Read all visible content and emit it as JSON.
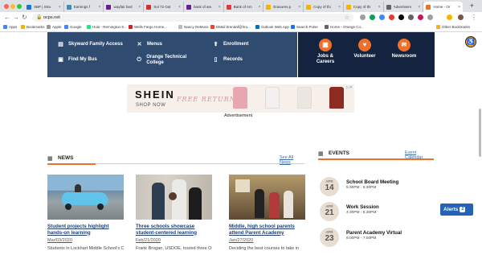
{
  "browser": {
    "tabs": [
      {
        "title": "SBP | Stra",
        "color": "#1a73e8"
      },
      {
        "title": "Earnings f",
        "color": "#3c8dbc"
      },
      {
        "title": "wayfair bed",
        "color": "#6a1b9a"
      },
      {
        "title": "Sol 72 Out",
        "color": "#d32f2f"
      },
      {
        "title": "bank of am",
        "color": "#6a1b9a"
      },
      {
        "title": "Bank of Am",
        "color": "#e53935"
      },
      {
        "title": "Erasures.p",
        "color": "#f4b400"
      },
      {
        "title": "Copy of thi",
        "color": "#f4b400"
      },
      {
        "title": "Copy of thi",
        "color": "#f4b400"
      },
      {
        "title": "Advertisem",
        "color": "#5f6368"
      },
      {
        "title": "Home - Or",
        "color": "#f0702b",
        "active": true
      }
    ],
    "url": "ocps.net",
    "bookmarks": [
      {
        "label": "Apps",
        "color": "#4285f4"
      },
      {
        "label": "Bookmarks",
        "color": "#f4b400"
      },
      {
        "label": "Apple",
        "color": "#999999"
      },
      {
        "label": "Google",
        "color": "#4285f4"
      },
      {
        "label": "Hulu - Remington S...",
        "color": "#1ce783"
      },
      {
        "label": "Wells Fargo Home...",
        "color": "#d71e28"
      },
      {
        "label": "Nancy DeMoss",
        "color": "#bbbbbb"
      },
      {
        "label": "DMail brendaf@hru...",
        "color": "#ea4335"
      },
      {
        "label": "Outlook Web App",
        "color": "#0072c6"
      },
      {
        "label": "Search Pulse",
        "color": "#1a73e8"
      },
      {
        "label": "Home - Orange Co...",
        "color": "#5f6368"
      },
      {
        "label": "Other Bookmarks",
        "color": "#f4b400"
      }
    ]
  },
  "quicklinks": [
    {
      "label": "Skyward Family Access",
      "icon": "card-icon"
    },
    {
      "label": "Menus",
      "icon": "utensils-icon"
    },
    {
      "label": "Enrollment",
      "icon": "arrow-up-icon"
    },
    {
      "label": "Find My Bus",
      "icon": "bus-icon"
    },
    {
      "label": "Orange Technical College",
      "icon": "power-icon"
    },
    {
      "label": "Records",
      "icon": "document-icon"
    }
  ],
  "featured": [
    {
      "label": "Jobs & Careers",
      "icon": "briefcase-icon"
    },
    {
      "label": "Volunteer",
      "icon": "heart-icon"
    },
    {
      "label": "Newsroom",
      "icon": "megaphone-icon"
    }
  ],
  "ad": {
    "brand": "SHEIN",
    "cta": "SHOP NOW",
    "script": "FREE RETURN",
    "label": "Advertisement"
  },
  "news": {
    "title": "NEWS",
    "see_all": "See All News",
    "stories": [
      {
        "title": "Student projects highlight hands-on learning",
        "date": "Mar/03/2020",
        "snippet": "Students in Lockhart Middle School's CASE"
      },
      {
        "title": "Three schools showcase student-centered learning",
        "date": "Feb/21/2020",
        "snippet": "Frank Brogan, USDOE, toured three OCPS"
      },
      {
        "title": "Middle, high school parents attend Parent Academy",
        "date": "Jan/27/2020",
        "snippet": "Deciding the best courses to take in"
      }
    ]
  },
  "events": {
    "title": "EVENTS",
    "calendar_link": "Event Calendar",
    "items": [
      {
        "month": "APR",
        "day": "14",
        "title": "School Board Meeting",
        "time": "5:30PM - 6:30PM"
      },
      {
        "month": "APR",
        "day": "21",
        "title": "Work Session",
        "time": "4:30PM - 6:30PM"
      },
      {
        "month": "APR",
        "day": "23",
        "title": "Parent Academy Virtual",
        "time": "6:00PM - 7:00PM"
      }
    ]
  },
  "alerts": {
    "label": "Alerts",
    "count": "2"
  }
}
